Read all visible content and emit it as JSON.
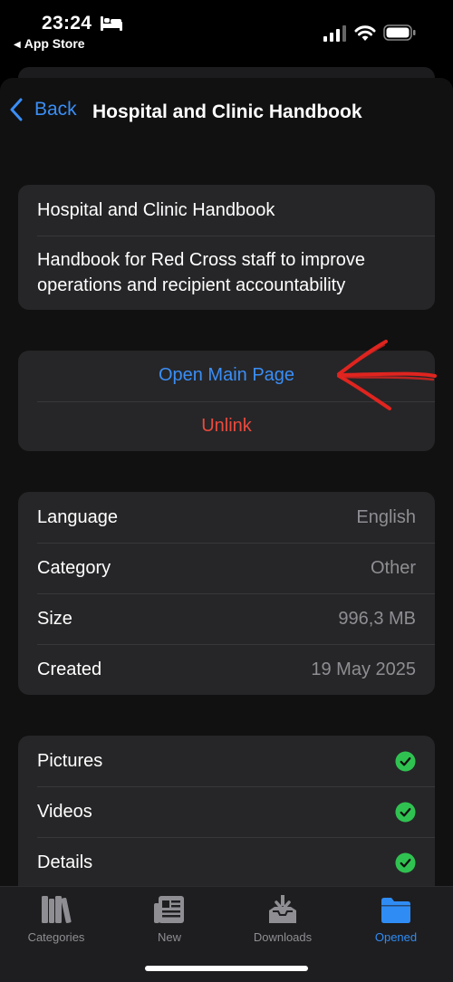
{
  "status_bar": {
    "time": "23:24",
    "back_app": "App Store",
    "icons": [
      "bed-icon",
      "signal-icon",
      "wifi-icon",
      "battery-icon"
    ]
  },
  "nav": {
    "back_label": "Back",
    "title": "Hospital and Clinic Handbook"
  },
  "info": {
    "title": "Hospital and Clinic Handbook",
    "description": "Handbook for Red Cross staff to improve operations and recipient accountability"
  },
  "actions": {
    "open_main_page": "Open Main Page",
    "unlink": "Unlink"
  },
  "metadata": [
    {
      "label": "Language",
      "value": "English"
    },
    {
      "label": "Category",
      "value": "Other"
    },
    {
      "label": "Size",
      "value": "996,3 MB"
    },
    {
      "label": "Created",
      "value": "19 May 2025"
    }
  ],
  "features": [
    {
      "label": "Pictures",
      "enabled": true
    },
    {
      "label": "Videos",
      "enabled": true
    },
    {
      "label": "Details",
      "enabled": true
    }
  ],
  "tabs": [
    {
      "label": "Categories",
      "icon": "books-icon",
      "active": false
    },
    {
      "label": "New",
      "icon": "newspaper-icon",
      "active": false
    },
    {
      "label": "Downloads",
      "icon": "tray-download-icon",
      "active": false
    },
    {
      "label": "Opened",
      "icon": "folder-icon",
      "active": true
    }
  ],
  "colors": {
    "accent": "#3a8ef6",
    "destructive": "#eb4a3e",
    "check": "#30c251",
    "annotation": "#e0241f"
  }
}
